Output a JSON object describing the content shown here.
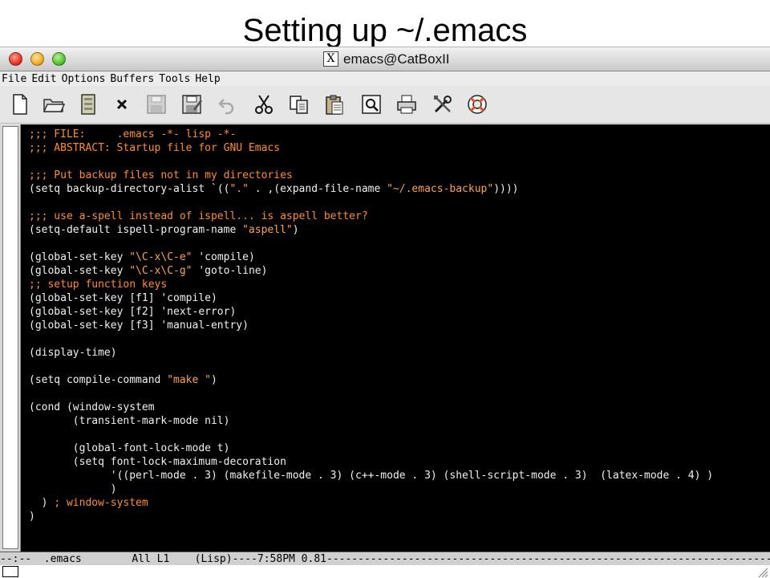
{
  "slide": {
    "title": "Setting up ~/.emacs"
  },
  "window": {
    "x_badge": "X",
    "title": "emacs@CatBoxII"
  },
  "menubar": {
    "items": [
      "File",
      "Edit",
      "Options",
      "Buffers",
      "Tools",
      "Help"
    ]
  },
  "toolbar": {
    "icons": [
      "new-file-icon",
      "open-folder-icon",
      "save-drive-icon",
      "close-x-icon",
      "floppy-save-icon",
      "floppy-edit-icon",
      "undo-icon",
      "cut-icon",
      "copy-icon",
      "paste-icon",
      "search-icon",
      "print-icon",
      "tools-icon",
      "help-lifebuoy-icon"
    ]
  },
  "editor": {
    "lines": [
      [
        {
          "t": ";;; FILE:     .emacs -*- lisp -*-",
          "c": "comment"
        }
      ],
      [
        {
          "t": ";;; ABSTRACT: Startup file for GNU Emacs",
          "c": "comment"
        }
      ],
      [],
      [
        {
          "t": ";;; Put backup files not in my directories",
          "c": "comment"
        }
      ],
      [
        {
          "t": "(setq backup-directory-alist `((",
          "c": "code"
        },
        {
          "t": "\".\"",
          "c": "string"
        },
        {
          "t": " . ,(expand-file-name ",
          "c": "code"
        },
        {
          "t": "\"~/.emacs-backup\"",
          "c": "string"
        },
        {
          "t": "))))",
          "c": "code"
        }
      ],
      [],
      [
        {
          "t": ";;; use a-spell instead of ispell... is aspell better?",
          "c": "comment"
        }
      ],
      [
        {
          "t": "(setq-default ispell-program-name ",
          "c": "code"
        },
        {
          "t": "\"aspell\"",
          "c": "string"
        },
        {
          "t": ")",
          "c": "code"
        }
      ],
      [],
      [
        {
          "t": "(global-set-key ",
          "c": "code"
        },
        {
          "t": "\"\\C-x\\C-e\"",
          "c": "string"
        },
        {
          "t": " 'compile)",
          "c": "code"
        }
      ],
      [
        {
          "t": "(global-set-key ",
          "c": "code"
        },
        {
          "t": "\"\\C-x\\C-g\"",
          "c": "string"
        },
        {
          "t": " 'goto-line)",
          "c": "code"
        }
      ],
      [
        {
          "t": ";; setup function keys",
          "c": "comment"
        }
      ],
      [
        {
          "t": "(global-set-key [f1] 'compile)",
          "c": "code"
        }
      ],
      [
        {
          "t": "(global-set-key [f2] 'next-error)",
          "c": "code"
        }
      ],
      [
        {
          "t": "(global-set-key [f3] 'manual-entry)",
          "c": "code"
        }
      ],
      [],
      [
        {
          "t": "(display-time)",
          "c": "code"
        }
      ],
      [],
      [
        {
          "t": "(setq compile-command ",
          "c": "code"
        },
        {
          "t": "\"make \"",
          "c": "string"
        },
        {
          "t": ")",
          "c": "code"
        }
      ],
      [],
      [
        {
          "t": "(cond (window-system",
          "c": "code"
        }
      ],
      [
        {
          "t": "       (transient-mark-mode nil)",
          "c": "code"
        }
      ],
      [],
      [
        {
          "t": "       (global-font-lock-mode t)",
          "c": "code"
        }
      ],
      [
        {
          "t": "       (setq font-lock-maximum-decoration",
          "c": "code"
        }
      ],
      [
        {
          "t": "             '((perl-mode . 3) (makefile-mode . 3) (c++-mode . 3) (shell-script-mode . 3)  (latex-mode . 4) )",
          "c": "code"
        }
      ],
      [
        {
          "t": "             )",
          "c": "code"
        }
      ],
      [
        {
          "t": "  ) ",
          "c": "code"
        },
        {
          "t": "; window-system",
          "c": "comment"
        }
      ],
      [
        {
          "t": ")",
          "c": "code"
        }
      ]
    ]
  },
  "modeline": {
    "text": "--:--  .emacs        All L1    (Lisp)----7:58PM 0.81-----------------------------------------------------------------------"
  },
  "colors": {
    "comment": "#ff8c2a",
    "string": "#ffa24a",
    "code": "#f0f0f0",
    "background": "#000000"
  }
}
